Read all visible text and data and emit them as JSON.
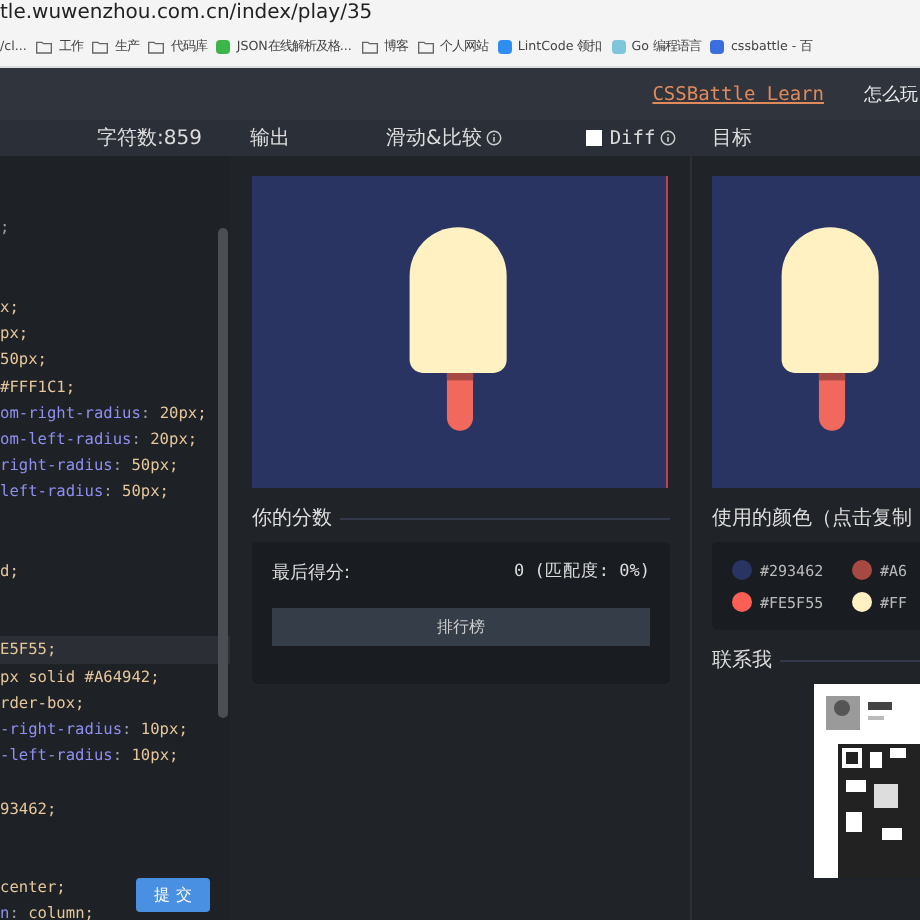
{
  "browser": {
    "url": "tle.wuwenzhou.com.cn/index/play/35",
    "bookmarks": [
      {
        "label": "/cl...",
        "kind": "plain"
      },
      {
        "label": "工作",
        "kind": "folder"
      },
      {
        "label": "生产",
        "kind": "folder"
      },
      {
        "label": "代码库",
        "kind": "folder"
      },
      {
        "label": "JSON在线解析及格...",
        "kind": "site",
        "color": "#3cb54a"
      },
      {
        "label": "博客",
        "kind": "folder"
      },
      {
        "label": "个人网站",
        "kind": "folder"
      },
      {
        "label": "LintCode 领扣",
        "kind": "site",
        "color": "#2f8df0"
      },
      {
        "label": "Go 编程语言",
        "kind": "site",
        "color": "#7fc6dd"
      },
      {
        "label": "cssbattle - 百",
        "kind": "site",
        "color": "#3b6fe0"
      }
    ]
  },
  "header": {
    "link": "CSSBattle Learn",
    "menu": "怎么玩"
  },
  "toolbar": {
    "char_count": "字符数:859",
    "output": "输出",
    "slide_compare": "滑动&比较",
    "diff": {
      "label": "Diff",
      "checked": false
    },
    "target": "目标"
  },
  "editor": {
    "submit": "提 交",
    "lines": [
      {
        "kind": "blank"
      },
      {
        "kind": "blank"
      },
      {
        "kind": "code",
        "highlighted": false,
        "segments": [
          {
            "text": ";",
            "kind": "plain"
          }
        ]
      },
      {
        "kind": "blank"
      },
      {
        "kind": "blank"
      },
      {
        "kind": "code",
        "highlighted": false,
        "segments": [
          {
            "text": "x;",
            "kind": "val"
          }
        ]
      },
      {
        "kind": "code",
        "highlighted": false,
        "segments": [
          {
            "text": "px;",
            "kind": "val"
          }
        ]
      },
      {
        "kind": "code",
        "highlighted": false,
        "segments": [
          {
            "text": "50px;",
            "kind": "val"
          }
        ]
      },
      {
        "kind": "code",
        "highlighted": false,
        "segments": [
          {
            "text": " #FFF1C1;",
            "kind": "val"
          }
        ]
      },
      {
        "kind": "code",
        "highlighted": false,
        "segments": [
          {
            "text": "om-right-radius",
            "kind": "prop"
          },
          {
            "text": ": ",
            "kind": "plain"
          },
          {
            "text": "20px;",
            "kind": "val"
          }
        ]
      },
      {
        "kind": "code",
        "highlighted": false,
        "segments": [
          {
            "text": "om-left-radius",
            "kind": "prop"
          },
          {
            "text": ": ",
            "kind": "plain"
          },
          {
            "text": "20px;",
            "kind": "val"
          }
        ]
      },
      {
        "kind": "code",
        "highlighted": false,
        "segments": [
          {
            "text": "right-radius",
            "kind": "prop"
          },
          {
            "text": ": ",
            "kind": "plain"
          },
          {
            "text": "50px;",
            "kind": "val"
          }
        ]
      },
      {
        "kind": "code",
        "highlighted": false,
        "segments": [
          {
            "text": "left-radius",
            "kind": "prop"
          },
          {
            "text": ": ",
            "kind": "plain"
          },
          {
            "text": "50px;",
            "kind": "val"
          }
        ]
      },
      {
        "kind": "blank"
      },
      {
        "kind": "blank"
      },
      {
        "kind": "code",
        "highlighted": false,
        "segments": [
          {
            "text": "d;",
            "kind": "val"
          }
        ]
      },
      {
        "kind": "blank"
      },
      {
        "kind": "blank"
      },
      {
        "kind": "code",
        "highlighted": true,
        "segments": [
          {
            "text": "E5F55;",
            "kind": "val"
          }
        ]
      },
      {
        "kind": "code",
        "highlighted": false,
        "segments": [
          {
            "text": "px solid #A64942;",
            "kind": "val"
          }
        ]
      },
      {
        "kind": "code",
        "highlighted": false,
        "segments": [
          {
            "text": "rder-box;",
            "kind": "val"
          }
        ]
      },
      {
        "kind": "code",
        "highlighted": false,
        "segments": [
          {
            "text": "-right-radius",
            "kind": "prop"
          },
          {
            "text": ": ",
            "kind": "plain"
          },
          {
            "text": "10px;",
            "kind": "val"
          }
        ]
      },
      {
        "kind": "code",
        "highlighted": false,
        "segments": [
          {
            "text": "-left-radius",
            "kind": "prop"
          },
          {
            "text": ": ",
            "kind": "plain"
          },
          {
            "text": "10px;",
            "kind": "val"
          }
        ]
      },
      {
        "kind": "blank"
      },
      {
        "kind": "code",
        "highlighted": false,
        "segments": [
          {
            "text": "93462;",
            "kind": "val"
          }
        ]
      },
      {
        "kind": "blank"
      },
      {
        "kind": "blank"
      },
      {
        "kind": "code",
        "highlighted": false,
        "segments": [
          {
            "text": "center;",
            "kind": "val"
          }
        ]
      },
      {
        "kind": "code",
        "highlighted": false,
        "segments": [
          {
            "text": "n",
            "kind": "prop"
          },
          {
            "text": ": ",
            "kind": "plain"
          },
          {
            "text": "column;",
            "kind": "val"
          }
        ]
      }
    ]
  },
  "output": {
    "score_title": "你的分数",
    "score_label": "最后得分:",
    "score_value": "0 (匹配度: 0%)",
    "leaderboard": "排行榜"
  },
  "target": {
    "colors_title": "使用的颜色（点击复制",
    "colors": [
      {
        "code": "#293462",
        "color": "#293462"
      },
      {
        "code": "#A6",
        "color": "#a64942"
      },
      {
        "code": "#FE5F55",
        "color": "#fe5f55"
      },
      {
        "code": "#FF",
        "color": "#fff1c1"
      }
    ],
    "contact_title": "联系我"
  }
}
